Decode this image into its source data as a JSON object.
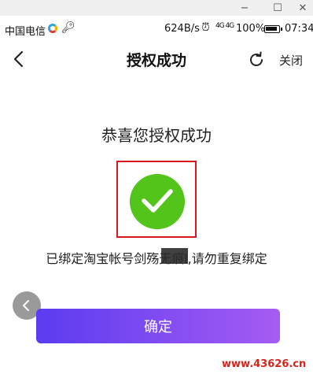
{
  "window": {
    "minimize_icon": "−",
    "maximize_icon": "☐",
    "close_icon": "✕"
  },
  "status_bar": {
    "carrier": "中国电信",
    "speed": "624B/s",
    "signal": "4G 4G",
    "battery": "100%",
    "time": "07:34"
  },
  "header": {
    "title": "授权成功",
    "close_label": "关闭"
  },
  "main": {
    "congrats": "恭喜您授权成功",
    "notice": "已绑定淘宝帐号剑殇无痕l,请勿重复绑定",
    "confirm_label": "确定"
  },
  "watermark": "www.43626.cn",
  "colors": {
    "success_green": "#52c41a",
    "highlight_red": "#d9161e",
    "button_gradient_start": "#5b3cf0",
    "button_gradient_end": "#a55cf2",
    "watermark_red": "#d8251b"
  },
  "icons": {
    "back": "chevron-left-icon",
    "refresh": "refresh-icon",
    "success": "checkmark-icon",
    "side_back": "chevron-left-icon"
  }
}
